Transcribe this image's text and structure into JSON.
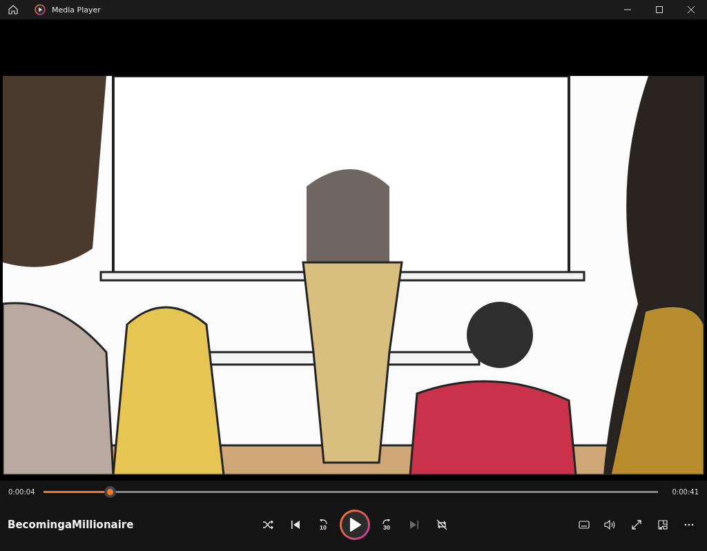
{
  "window": {
    "title": "Media Player"
  },
  "progress": {
    "elapsed": "0:00:04",
    "level": 0.108,
    "total": "0:00:41"
  },
  "now_playing": {
    "title": "BecomingaMillionaire"
  },
  "controls": [
    {
      "kind": "shuffle",
      "disabled": false
    },
    {
      "kind": "previous",
      "disabled": false
    },
    {
      "kind": "skip_back",
      "label": "10",
      "disabled": false
    },
    {
      "kind": "play",
      "disabled": false
    },
    {
      "kind": "skip_forward",
      "label": "30",
      "disabled": false
    },
    {
      "kind": "next",
      "disabled": true
    },
    {
      "kind": "repeat",
      "disabled": false
    }
  ],
  "right_controls": [
    {
      "kind": "subtitles"
    },
    {
      "kind": "volume"
    },
    {
      "kind": "fullscreen"
    },
    {
      "kind": "mini_player"
    },
    {
      "kind": "more"
    }
  ]
}
